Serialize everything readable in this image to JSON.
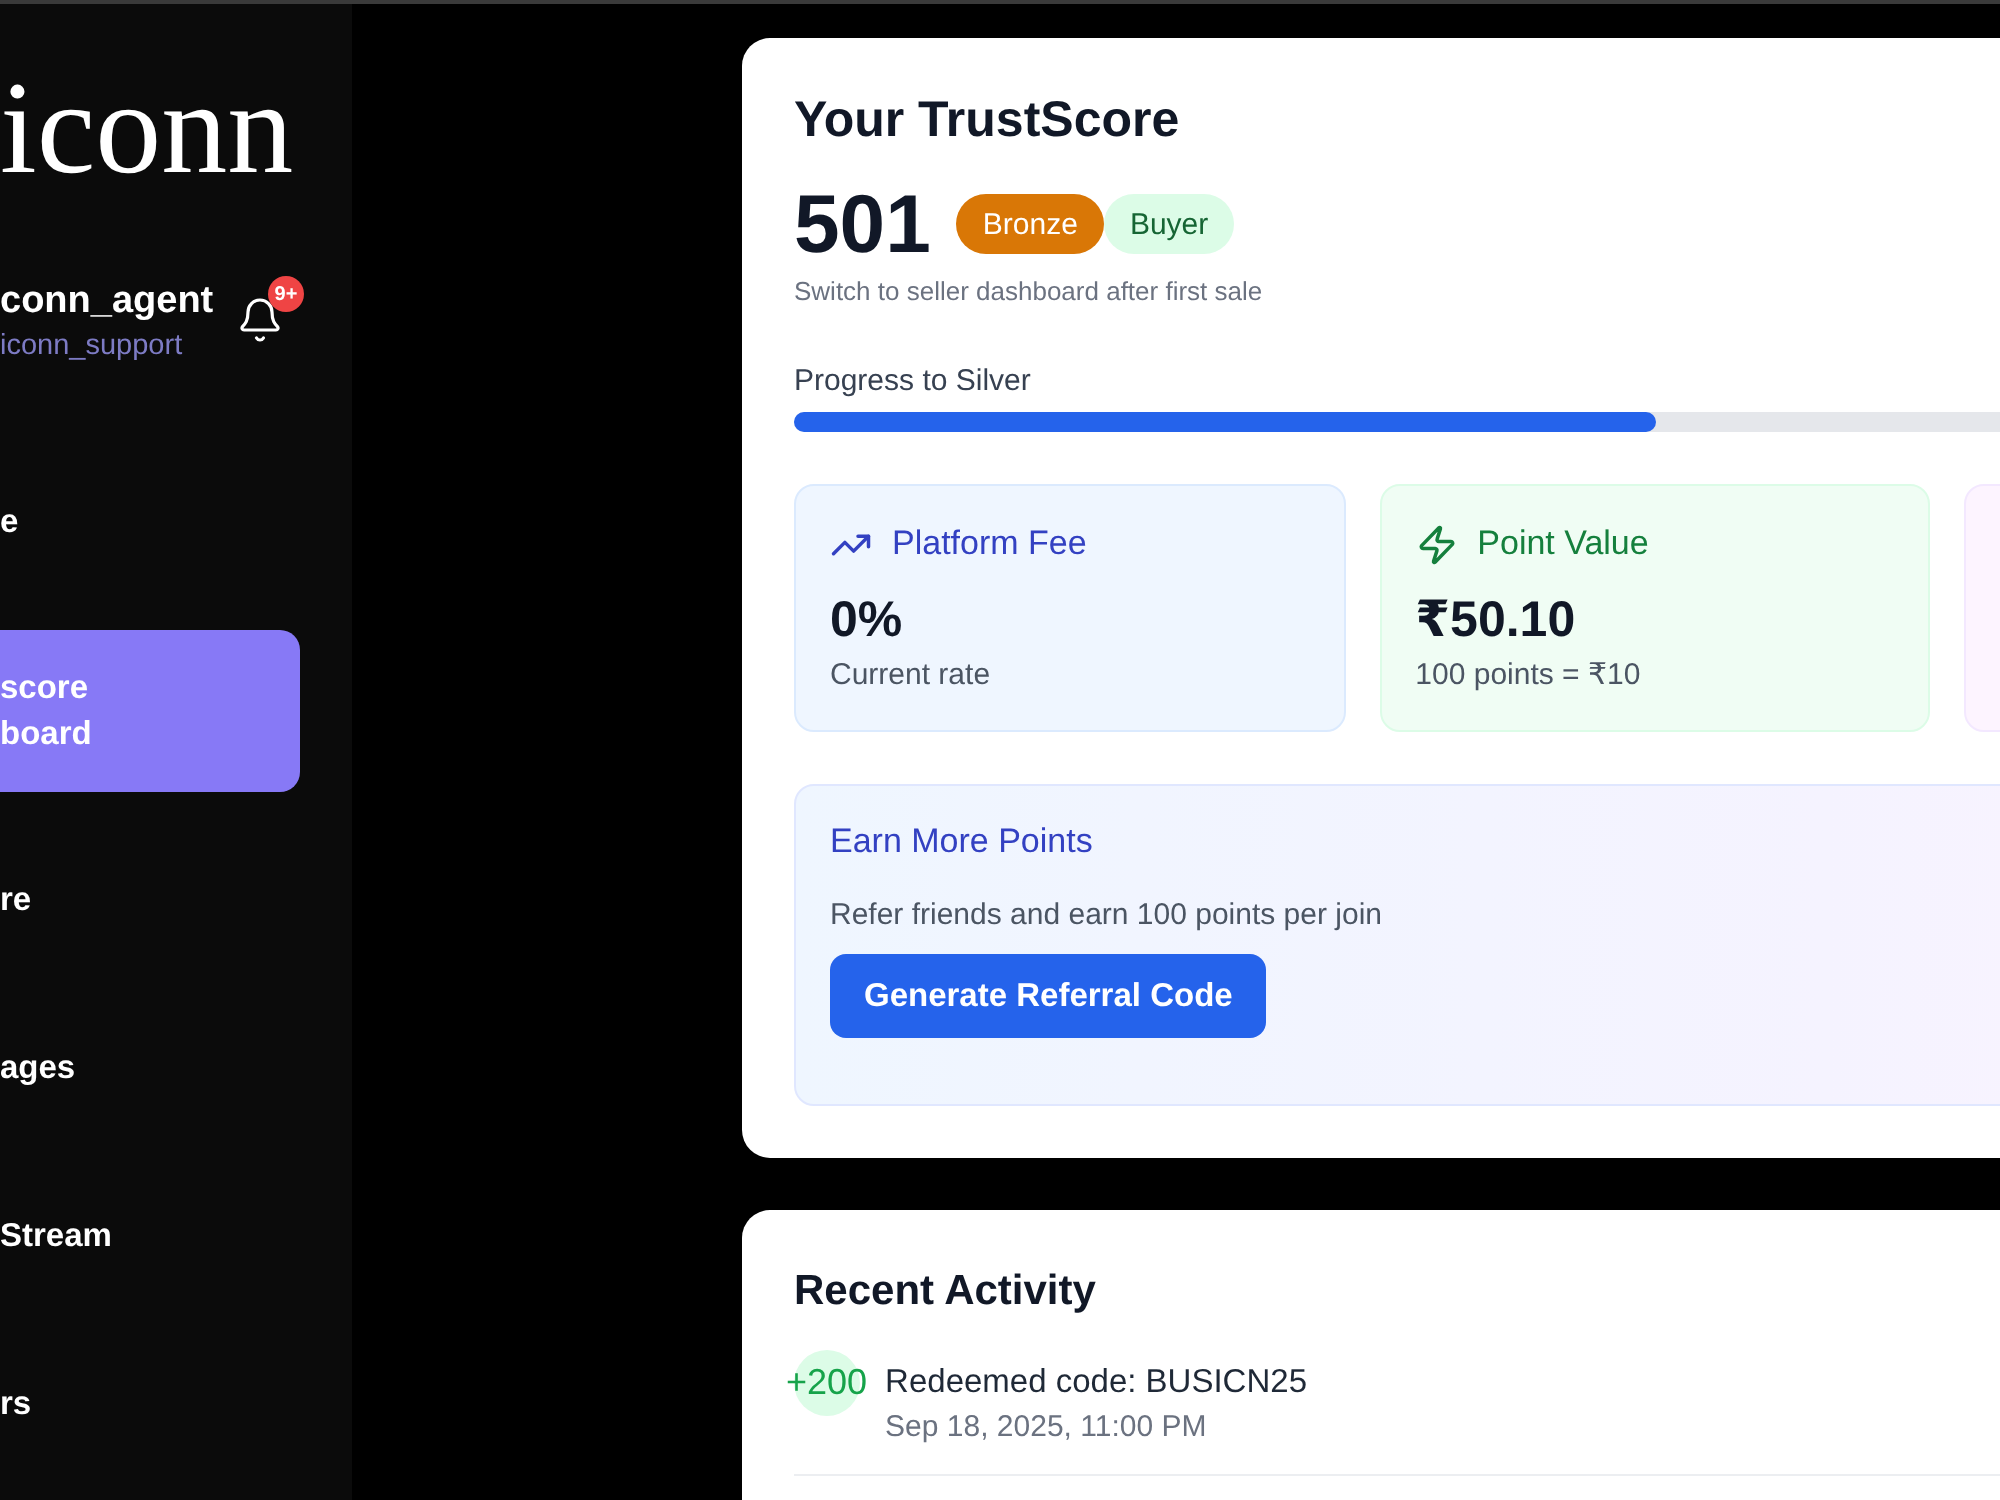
{
  "sidebar": {
    "logo": "iconn",
    "user": {
      "name": "conn_agent",
      "handle": "iconn_support"
    },
    "notifications": {
      "badge": "9+"
    },
    "nav": [
      {
        "label": "e",
        "selected": false
      },
      {
        "label": "score board",
        "selected": true
      },
      {
        "label": "re",
        "selected": false
      },
      {
        "label": "ages",
        "selected": false
      },
      {
        "label": "Stream",
        "selected": false
      },
      {
        "label": "rs",
        "selected": false
      }
    ]
  },
  "trust_card": {
    "title": "Your TrustScore",
    "score": "501",
    "badges": [
      {
        "label": "Bronze",
        "kind": "tier"
      },
      {
        "label": "Buyer",
        "kind": "role"
      }
    ],
    "note": "Switch to seller dashboard after first sale",
    "progress": {
      "label": "Progress to Silver",
      "level": 0.5
    },
    "stats": [
      {
        "kind": "fee",
        "title": "Platform Fee",
        "value": "0%",
        "caption": "Current rate"
      },
      {
        "kind": "points",
        "title": "Point Value",
        "value": "₹50.10",
        "caption": "100 points = ₹10"
      },
      {
        "kind": "blank"
      }
    ],
    "earn": {
      "title": "Earn More Points",
      "text": "Refer friends and earn 100 points per join",
      "button": "Generate Referral Code"
    }
  },
  "activity": {
    "title": "Recent Activity",
    "items": [
      {
        "points": "+200",
        "title": "Redeemed code: BUSICN25",
        "time": "Sep 18, 2025, 11:00 PM"
      }
    ]
  }
}
